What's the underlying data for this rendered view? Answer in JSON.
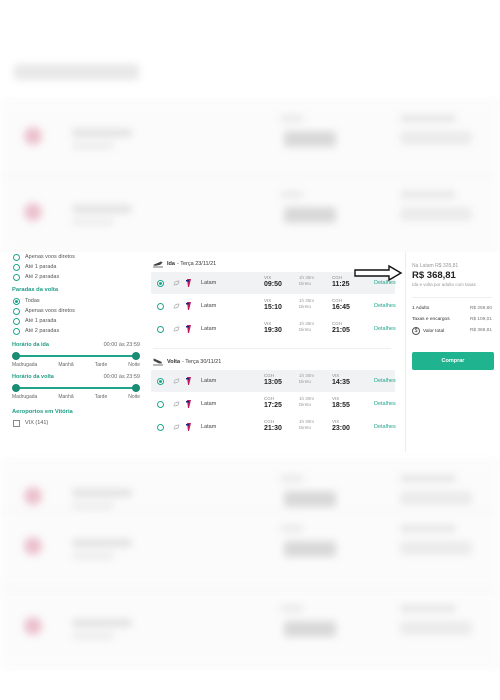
{
  "filters": {
    "outbound_stops_tail": [
      {
        "label": "Apenas voos diretos",
        "selected": false
      },
      {
        "label": "Até 1 parada",
        "selected": false
      },
      {
        "label": "Até 2 paradas",
        "selected": false
      }
    ],
    "return_stops": {
      "title": "Paradas da volta",
      "options": [
        {
          "label": "Todas",
          "selected": true
        },
        {
          "label": "Apenas voos diretos",
          "selected": false
        },
        {
          "label": "Até 1 parada",
          "selected": false
        },
        {
          "label": "Até 2 paradas",
          "selected": false
        }
      ]
    },
    "departure_time": {
      "title": "Horário da ida",
      "range": "00:00 às 23:59"
    },
    "return_time": {
      "title": "Horário da volta",
      "range": "00:00 às 23:59"
    },
    "periods": [
      "Madrugada",
      "Manhã",
      "Tarde",
      "Noite"
    ],
    "airports": {
      "title": "Aeroportos em Vitória",
      "option": "VIX (141)"
    }
  },
  "outbound": {
    "label": "Ida",
    "date": "- Terça 23/11/21",
    "flights": [
      {
        "airline": "Latam",
        "from_code": "VIX",
        "dep": "09:50",
        "duration": "1h 35m",
        "type": "Direto",
        "to_code": "CGH",
        "arr": "11:25",
        "details": "Detalhes",
        "selected": true
      },
      {
        "airline": "Latam",
        "from_code": "VIX",
        "dep": "15:10",
        "duration": "1h 35m",
        "type": "Direto",
        "to_code": "CGH",
        "arr": "16:45",
        "details": "Detalhes",
        "selected": false
      },
      {
        "airline": "Latam",
        "from_code": "VIX",
        "dep": "19:30",
        "duration": "1h 35m",
        "type": "Direto",
        "to_code": "CGH",
        "arr": "21:05",
        "details": "Detalhes",
        "selected": false
      }
    ]
  },
  "return": {
    "label": "Volta",
    "date": "- Terça 30/11/21",
    "flights": [
      {
        "airline": "Latam",
        "from_code": "CGH",
        "dep": "13:05",
        "duration": "1h 30m",
        "type": "Direto",
        "to_code": "VIX",
        "arr": "14:35",
        "details": "Detalhes",
        "selected": true
      },
      {
        "airline": "Latam",
        "from_code": "CGH",
        "dep": "17:25",
        "duration": "1h 30m",
        "type": "Direto",
        "to_code": "VIX",
        "arr": "18:55",
        "details": "Detalhes",
        "selected": false
      },
      {
        "airline": "Latam",
        "from_code": "CGH",
        "dep": "21:30",
        "duration": "1h 30m",
        "type": "Direto",
        "to_code": "VIX",
        "arr": "23:00",
        "details": "Detalhes",
        "selected": false
      }
    ]
  },
  "summary": {
    "from_label": "Na Latam R$ 328,81",
    "price": "R$ 368,81",
    "note": "Ida e volta por adulto com taxas",
    "rows": [
      {
        "label": "1 Adulto",
        "value": "R$ 259,80"
      },
      {
        "label": "Taxas e encargos",
        "value": "R$ 109,01"
      },
      {
        "label": "Valor total",
        "value": "R$ 368,81"
      }
    ],
    "buy_label": "Comprar"
  },
  "colors": {
    "accent": "#1fa58c",
    "button": "#20b38f",
    "airline_logo": "#c2185b"
  }
}
